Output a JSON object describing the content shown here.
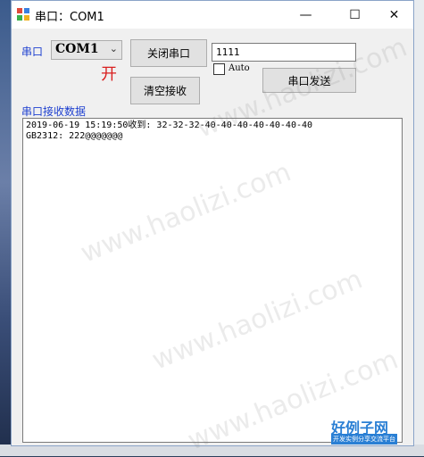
{
  "window": {
    "title": "串口：COM1",
    "controls": {
      "minimize": "—",
      "maximize": "☐",
      "close": "✕"
    }
  },
  "port": {
    "label": "串口",
    "selected": "COM1",
    "state": "开"
  },
  "buttons": {
    "close_port": "关闭串口",
    "clear_receive": "清空接收",
    "send": "串口发送"
  },
  "send_input": {
    "value": "1111"
  },
  "auto": {
    "label": "Auto",
    "checked": false
  },
  "receive": {
    "label": "串口接收数据",
    "text": "2019-06-19 15:19:50收到: 32-32-32-40-40-40-40-40-40-40\nGB2312: 222@@@@@@@"
  },
  "watermark": "www.haolizi.com",
  "logo": {
    "main": "好例子网",
    "sub": "开发实例分享交流平台"
  },
  "colors": {
    "label_blue": "#1d3fcf",
    "state_red": "#d91f1f"
  }
}
